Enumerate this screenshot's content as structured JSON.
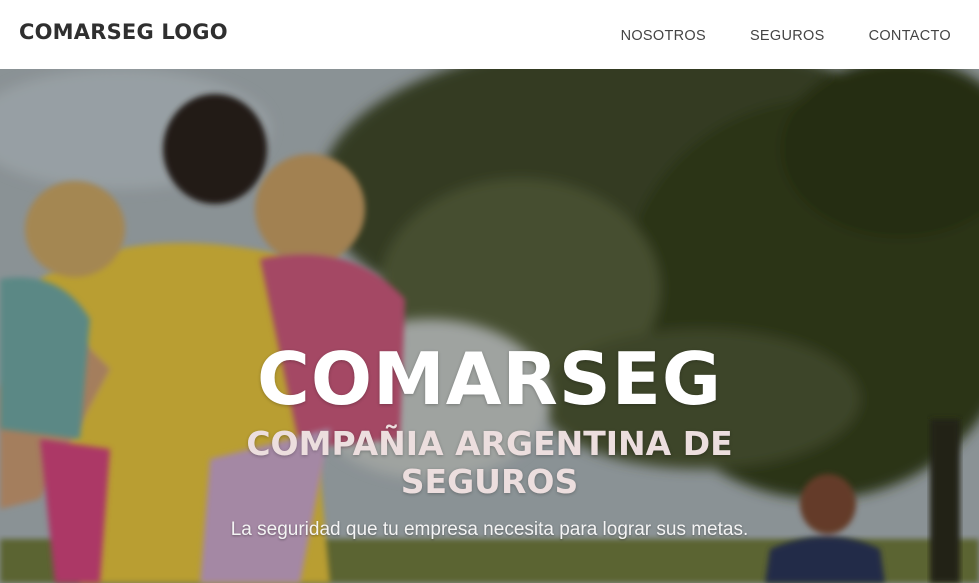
{
  "nav": {
    "logo": "COMARSEG LOGO",
    "links": [
      "NOSOTROS",
      "SEGUROS",
      "CONTACTO"
    ]
  },
  "hero": {
    "title": "COMARSEG",
    "subtitle": "COMPAÑIA ARGENTINA DE SEGUROS",
    "tagline": "La seguridad que tu empresa necesita para lograr sus metas."
  },
  "colors": {
    "title": "#ffffff",
    "subtitle": "#ecdede",
    "nav_text": "#444444",
    "logo_text": "#2f2f2f"
  }
}
